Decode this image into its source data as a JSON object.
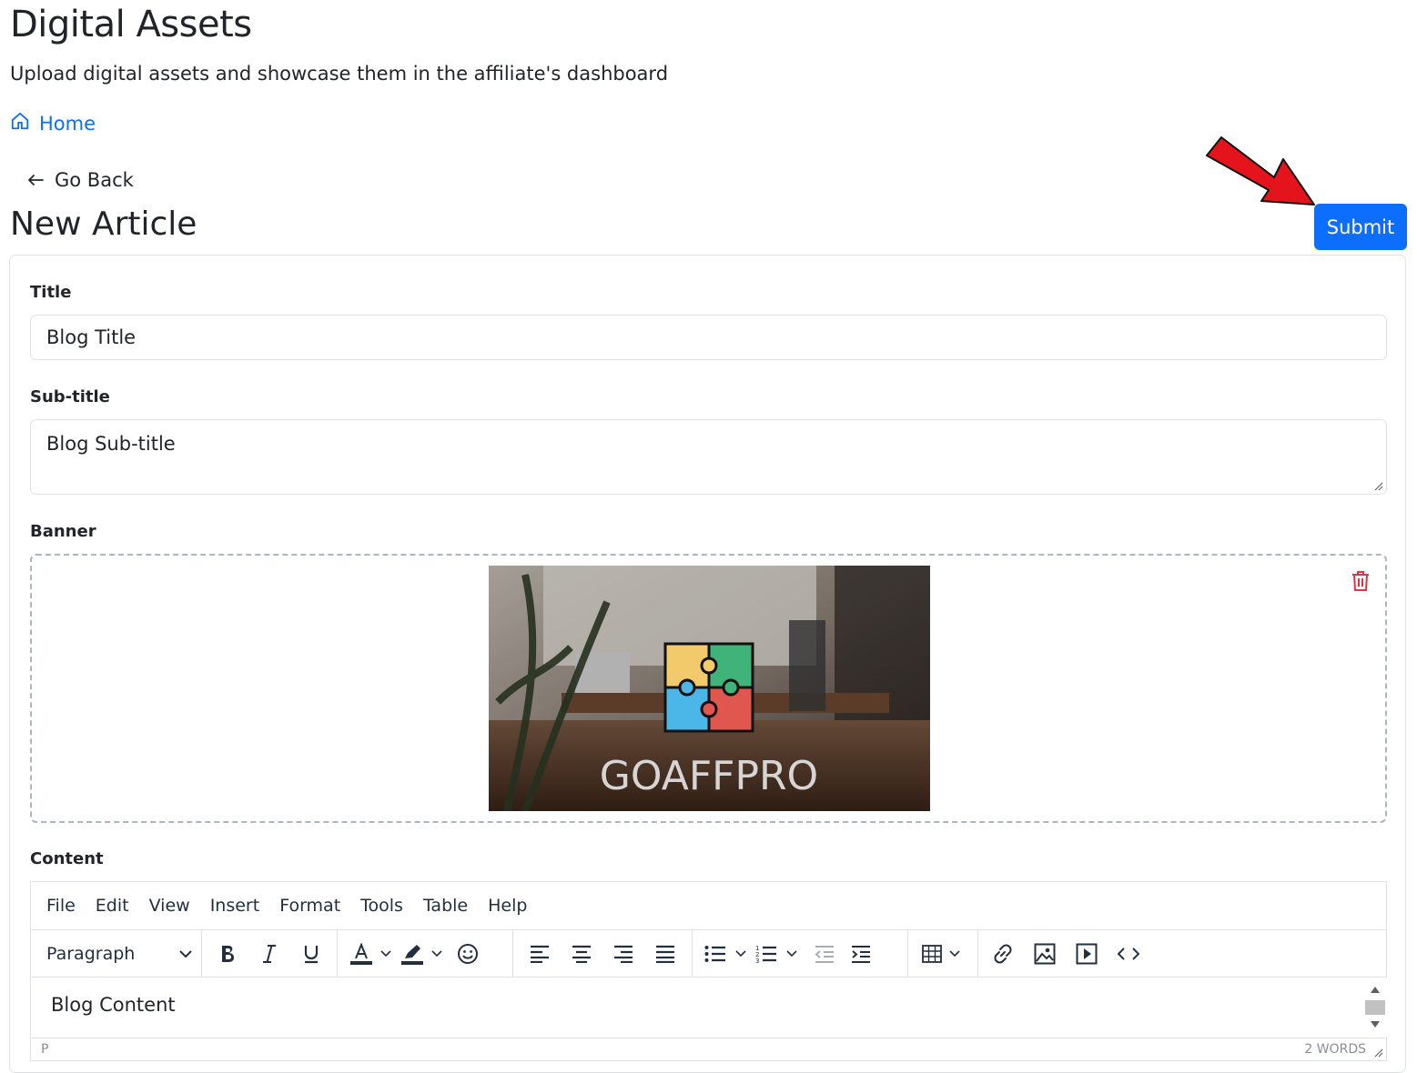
{
  "header": {
    "title": "Digital Assets",
    "subtitle": "Upload digital assets and showcase them in the affiliate's dashboard",
    "home_label": "Home"
  },
  "nav": {
    "back_label": "Go Back"
  },
  "article": {
    "heading": "New Article",
    "submit_label": "Submit"
  },
  "form": {
    "title_label": "Title",
    "title_value": "Blog Title",
    "subtitle_label": "Sub-title",
    "subtitle_value": "Blog Sub-title",
    "banner_label": "Banner",
    "banner_logo_text": "GOAFFPRO",
    "content_label": "Content"
  },
  "editor": {
    "menus": [
      "File",
      "Edit",
      "View",
      "Insert",
      "Format",
      "Tools",
      "Table",
      "Help"
    ],
    "block_format": "Paragraph",
    "content": "Blog Content",
    "status_path": "P",
    "word_count": "2 WORDS"
  },
  "colors": {
    "primary": "#0d6efd",
    "danger": "#dc3545",
    "annotation_arrow": "#e3141b"
  }
}
